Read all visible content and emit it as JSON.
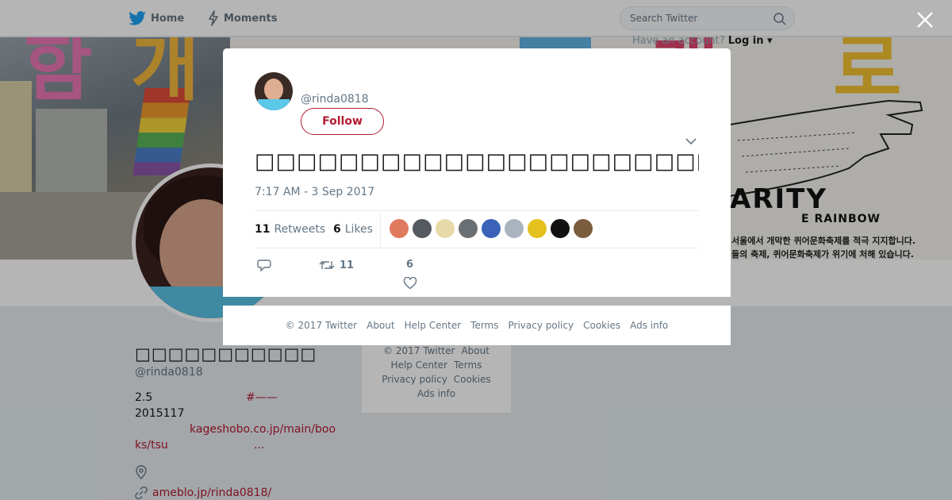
{
  "nav": {
    "home_label": "Home",
    "moments_label": "Moments",
    "search_placeholder": "Search Twitter",
    "have_account": "Have an account?",
    "login_label": "Log in"
  },
  "banner": {
    "korean_big": [
      "함",
      "개",
      "개",
      "로"
    ],
    "solidarity_text": "ARITY",
    "rainbow_text": "E RAINBOW",
    "korean_line1": "서울에서 개막한 퀴어문화축제를 적극 지지합니다.",
    "korean_line2": "들의 축제, 퀴어문화축제가 위기에 처해 있습니다."
  },
  "profile": {
    "name": "□□□□□□□□□□□",
    "handle": "@rinda0818",
    "bio_line1_a": "2.5",
    "bio_line1_b": "#——",
    "bio_line2": "2015117",
    "bio_link_a": "kageshobo.co.jp/main/boo",
    "bio_link_b": "ks/tsu",
    "bio_link_ellipsis": "...",
    "website": "ameblo.jp/rinda0818/",
    "footer_items": [
      "© 2017 Twitter",
      "About",
      "Help Center",
      "Terms",
      "Privacy policy",
      "Cookies",
      "Ads info"
    ]
  },
  "tweet": {
    "handle": "@rinda0818",
    "follow_label": "Follow",
    "text": "□□□□□□□□□□□□□□□□□□□□□□□□□□□□□□□□□□□□□",
    "timestamp": "7:17 AM - 3 Sep 2017",
    "retweets_count": "11",
    "retweets_label": "Retweets",
    "likes_count": "6",
    "likes_label": "Likes",
    "action_retweet_count": "11",
    "action_like_count": "6",
    "likers": [
      "#e07a5f",
      "#555a60",
      "#e8d9a8",
      "#6a6f73",
      "#3b62b8",
      "#a9b4bf",
      "#e5c11e",
      "#111111",
      "#7a5c3e"
    ]
  },
  "modal_footer": [
    "© 2017 Twitter",
    "About",
    "Help Center",
    "Terms",
    "Privacy policy",
    "Cookies",
    "Ads info"
  ],
  "colors": {
    "brand": "#1da1f2",
    "accent": "#b31b33",
    "muted": "#657786"
  }
}
